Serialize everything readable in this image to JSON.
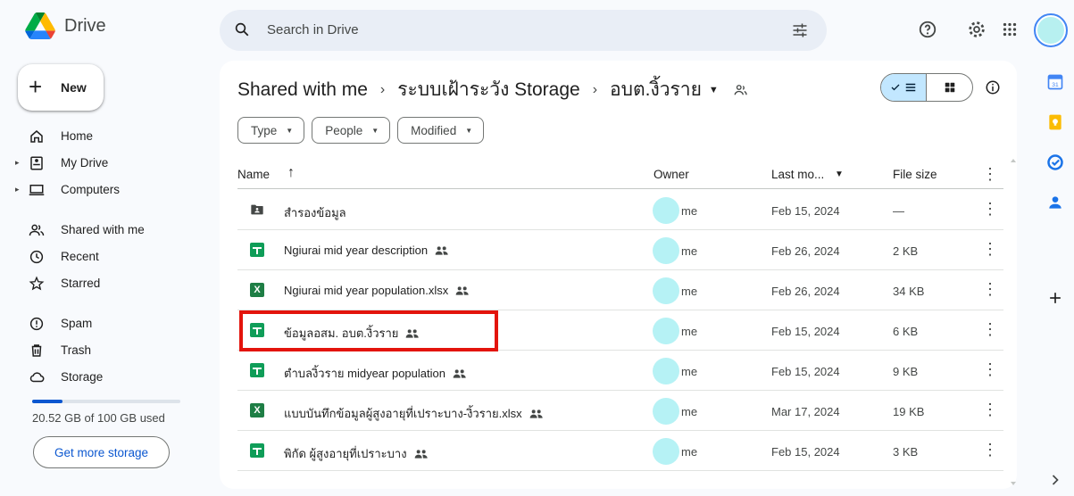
{
  "app": {
    "name": "Drive"
  },
  "search": {
    "placeholder": "Search in Drive"
  },
  "sidebar": {
    "new_label": "New",
    "items": [
      {
        "label": "Home",
        "icon": "home-icon"
      },
      {
        "label": "My Drive",
        "icon": "my-drive-icon"
      },
      {
        "label": "Computers",
        "icon": "computers-icon"
      },
      {
        "label": "Shared with me",
        "icon": "shared-icon"
      },
      {
        "label": "Recent",
        "icon": "clock-icon"
      },
      {
        "label": "Starred",
        "icon": "star-icon"
      },
      {
        "label": "Spam",
        "icon": "spam-icon"
      },
      {
        "label": "Trash",
        "icon": "trash-icon"
      },
      {
        "label": "Storage",
        "icon": "cloud-icon"
      }
    ],
    "storage_text": "20.52 GB of 100 GB used",
    "storage_fraction": 0.2052,
    "get_more_label": "Get more storage"
  },
  "breadcrumb": {
    "items": [
      "Shared with me",
      "ระบบเฝ้าระวัง Storage",
      "อบต.งิ้วราย"
    ]
  },
  "filters": [
    "Type",
    "People",
    "Modified"
  ],
  "table": {
    "headers": {
      "name": "Name",
      "owner": "Owner",
      "modified": "Last mo...",
      "size": "File size"
    },
    "rows": [
      {
        "name": "สำรองข้อมูล",
        "type": "shared-folder",
        "shared": false,
        "owner": "me",
        "modified": "Feb 15, 2024",
        "size": "—"
      },
      {
        "name": "Ngiurai mid year description",
        "type": "sheets",
        "shared": true,
        "owner": "me",
        "modified": "Feb 26, 2024",
        "size": "2 KB"
      },
      {
        "name": "Ngiurai mid year population.xlsx",
        "type": "excel",
        "shared": true,
        "owner": "me",
        "modified": "Feb 26, 2024",
        "size": "34 KB"
      },
      {
        "name": "ข้อมูลอสม. อบต.งิ้วราย",
        "type": "sheets",
        "shared": true,
        "owner": "me",
        "modified": "Feb 15, 2024",
        "size": "6 KB"
      },
      {
        "name": "ตำบลงิ้วราย midyear population",
        "type": "sheets",
        "shared": true,
        "owner": "me",
        "modified": "Feb 15, 2024",
        "size": "9 KB"
      },
      {
        "name": "แบบบันทึกข้อมูลผู้สูงอายุที่เปราะบาง-งิ้วราย.xlsx",
        "type": "excel",
        "shared": true,
        "owner": "me",
        "modified": "Mar 17, 2024",
        "size": "19 KB"
      },
      {
        "name": "พิกัด ผู้สูงอายุที่เปราะบาง",
        "type": "sheets",
        "shared": true,
        "owner": "me",
        "modified": "Feb 15, 2024",
        "size": "3 KB"
      }
    ]
  },
  "colors": {
    "accent": "#0b57d0",
    "sheets": "#0f9d58",
    "excel": "#1e7e45",
    "highlight": "#e3140c"
  }
}
